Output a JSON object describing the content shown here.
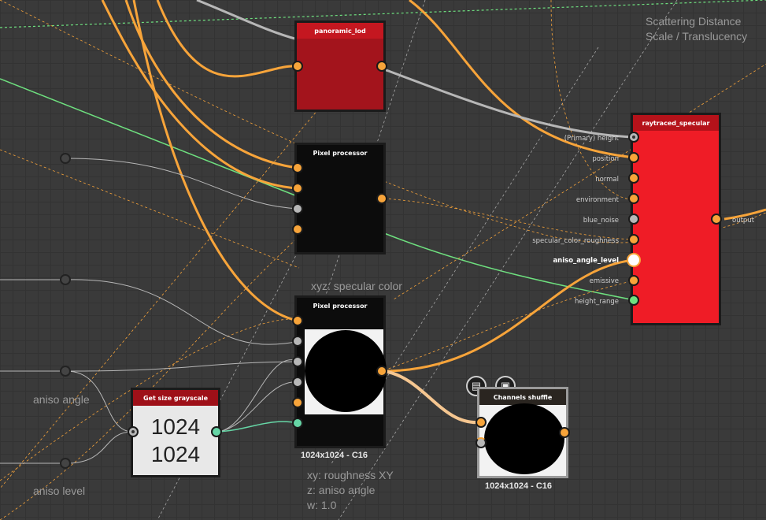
{
  "colors": {
    "canvas": "#3a3a3a",
    "accent_orange": "#f7a43a",
    "node_red": "#e8202a",
    "node_dark_red": "#a3141c",
    "wire_green": "#6ee07f",
    "wire_grey": "#b7b7b7"
  },
  "comments": {
    "scattering": "Scattering Distance",
    "scattering2": "Scale / Translucency",
    "xyz": "xyz: specular color",
    "xy": "xy: roughness XY",
    "z": "z: aniso angle",
    "w": "w: 1.0",
    "aniso_angle": "aniso angle",
    "aniso_level": "aniso level"
  },
  "nodes": {
    "panoramic": {
      "title": "panoramic_lod"
    },
    "pixel_processor_1": {
      "title": "Pixel processor"
    },
    "pixel_processor_2": {
      "title": "Pixel processor",
      "resolution": "1024x1024 - C16"
    },
    "get_size": {
      "title": "Get size grayscale",
      "width": "1024",
      "height": "1024"
    },
    "channels_shuffle": {
      "title": "Channels shuffle",
      "resolution": "1024x1024 - C16",
      "icons": [
        "document-icon",
        "checker-icon"
      ]
    },
    "raytraced": {
      "title": "raytraced_specular",
      "inputs": [
        "(Primary) height",
        "position",
        "normal",
        "environment",
        "blue_noise",
        "specular_color_roughness",
        "aniso_angle_level",
        "emissive",
        "height_range"
      ],
      "output": "output"
    }
  }
}
